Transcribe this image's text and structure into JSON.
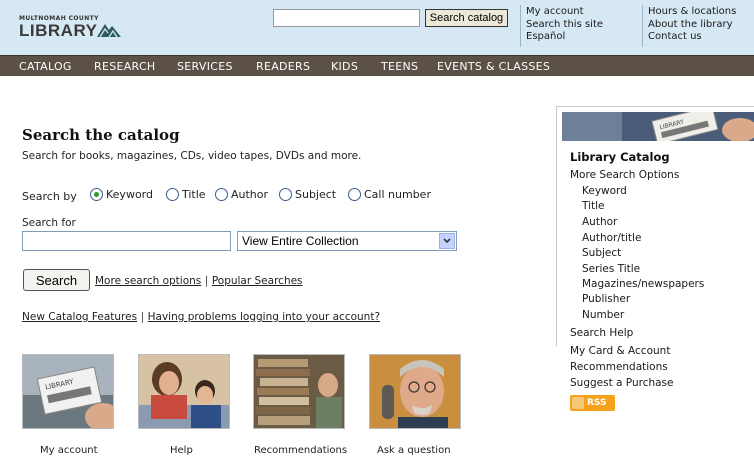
{
  "header": {
    "logo_county": "MULTNOMAH COUNTY",
    "logo_library": "LIBRARY",
    "search_placeholder": "",
    "search_button": "Search catalog",
    "links_col1": [
      "My account",
      "Search this site",
      "Español"
    ],
    "links_col2": [
      "Hours & locations",
      "About the library",
      "Contact us"
    ]
  },
  "nav": [
    "CATALOG",
    "RESEARCH",
    "SERVICES",
    "READERS",
    "KIDS",
    "TEENS",
    "EVENTS & CLASSES"
  ],
  "main": {
    "title": "Search the catalog",
    "description": "Search for books, magazines, CDs, video tapes, DVDs and more.",
    "search_by_label": "Search by",
    "search_by_options": [
      "Keyword",
      "Title",
      "Author",
      "Subject",
      "Call number"
    ],
    "search_by_selected": "Keyword",
    "search_for_label": "Search for",
    "search_for_value": "",
    "collection_selected": "View Entire Collection",
    "search_button": "Search",
    "more_options_link": "More search options",
    "separator": "|",
    "popular_link": "Popular Searches",
    "new_features_link": "New Catalog Features",
    "problems_link": "Having problems logging into your account?"
  },
  "tiles": [
    {
      "caption": "My account",
      "image_text": "LIBRARY"
    },
    {
      "caption": "Help"
    },
    {
      "caption": "Recommendations"
    },
    {
      "caption": "Ask a question"
    }
  ],
  "sidebar": {
    "image_text": "LIBRARY",
    "heading": "Library Catalog",
    "more_options": "More Search Options",
    "sub_items": [
      "Keyword",
      "Title",
      "Author",
      "Author/title",
      "Subject",
      "Series Title",
      "Magazines/newspapers",
      "Publisher",
      "Number"
    ],
    "links": [
      "Search Help",
      "My Card & Account",
      "Recommendations",
      "Suggest a Purchase"
    ],
    "rss": "RSS"
  },
  "colors": {
    "header_bg": "#d6e8f3",
    "nav_bg": "#5b5146",
    "radio_selected": "#2b9a2b",
    "rss": "#f6a11c"
  }
}
